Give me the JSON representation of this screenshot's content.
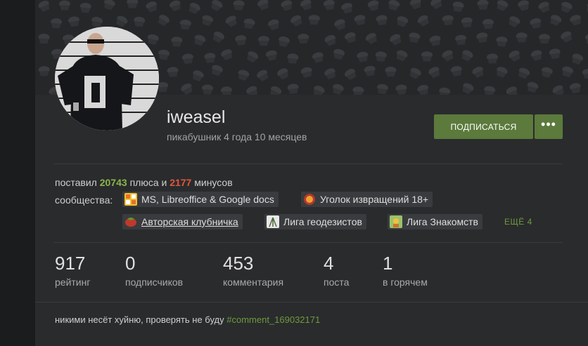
{
  "colors": {
    "accent_green": "#5b7a3b",
    "plus_green": "#8ab64a",
    "minus_red": "#e0573c",
    "link_green": "#6e9a3e",
    "background": "#1b1c1e",
    "card": "#2a2b2d",
    "tag_bg": "#3a3b3e"
  },
  "profile": {
    "username": "iweasel",
    "tenure": "пикабушник 4 года 10 месяцев",
    "avatar_icon": "user-avatar-photo"
  },
  "actions": {
    "subscribe_label": "ПОДПИСАТЬСЯ",
    "more_label": "•••",
    "more_icon": "ellipsis-icon"
  },
  "votes": {
    "prefix": "поставил",
    "plus_count": "20743",
    "plus_word": "плюса и",
    "minus_count": "2177",
    "minus_word": "минусов"
  },
  "communities": {
    "label": "сообщества:",
    "items": [
      {
        "name": "MS, Libreoffice & Google docs",
        "icon": "office-icon"
      },
      {
        "name": "Уголок извращений 18+",
        "icon": "planet-icon"
      },
      {
        "name": "Авторская клубничка",
        "icon": "strawberry-icon"
      },
      {
        "name": "Лига геодезистов",
        "icon": "surveyor-icon"
      },
      {
        "name": "Лига Знакомств",
        "icon": "dating-icon"
      }
    ],
    "more_label": "ЕЩЁ 4"
  },
  "stats": [
    {
      "value": "917",
      "label": "рейтинг"
    },
    {
      "value": "0",
      "label": "подписчиков"
    },
    {
      "value": "453",
      "label": "комментария"
    },
    {
      "value": "4",
      "label": "поста"
    },
    {
      "value": "1",
      "label": "в горячем"
    }
  ],
  "note": {
    "text": "никими несёт хуйню, проверять не буду ",
    "link": "#comment_169032171"
  }
}
